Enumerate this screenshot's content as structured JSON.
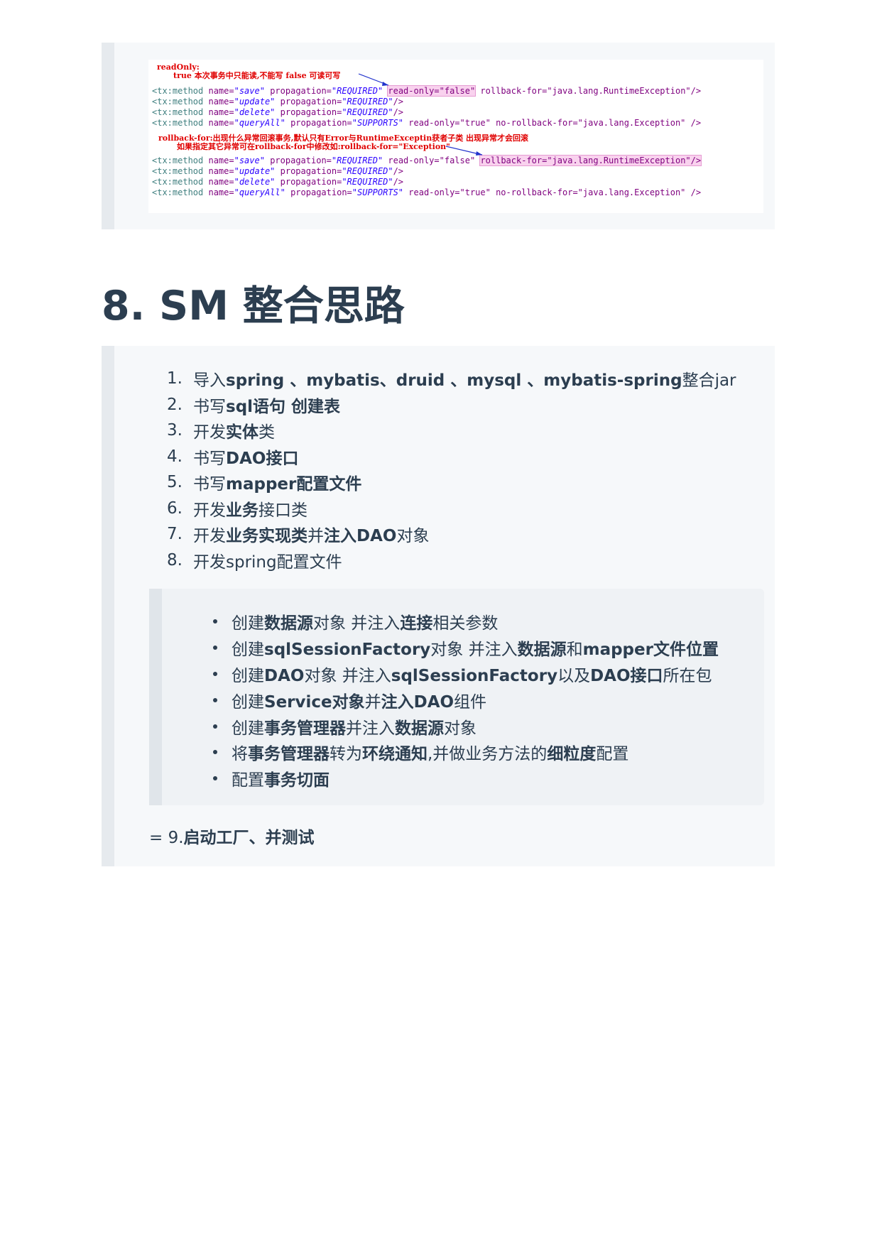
{
  "code_image": {
    "note1_line1": "readOnly:",
    "note1_line2": "true 本次事务中只能读,不能写 false 可读可写",
    "note2_line1": "rollback-for:出现什么异常回滚事务,默认只有Error与RuntimeExceptin获者子类 出现异常才会回滚",
    "note2_line2": "如果指定其它异常可在rollback-for中修改如:rollback-for=\"Exception\"",
    "block1": [
      {
        "name": "\"save\"",
        "prop": "\"REQUIRED\"",
        "extra": "read-only=\"false\"",
        "tail": " rollback-for=\"java.lang.RuntimeException\"/>"
      },
      {
        "name": "\"update\"",
        "prop": "\"REQUIRED\"",
        "extra": "",
        "tail": "/>"
      },
      {
        "name": "\"delete\"",
        "prop": "\"REQUIRED\"",
        "extra": "",
        "tail": "/>"
      },
      {
        "name": "\"queryAll\"",
        "prop": "\"SUPPORTS\"",
        "extra": "read-only=\"true\"",
        "tail": " no-rollback-for=\"java.lang.Exception\" />"
      }
    ],
    "block2": [
      {
        "name": "\"save\"",
        "prop": "\"REQUIRED\"",
        "extra": "read-only=\"false\"",
        "tail": "rollback-for=\"java.lang.RuntimeException\"/>"
      },
      {
        "name": "\"update\"",
        "prop": "\"REQUIRED\"",
        "extra": "",
        "tail": "/>"
      },
      {
        "name": "\"delete\"",
        "prop": "\"REQUIRED\"",
        "extra": "",
        "tail": "/>"
      },
      {
        "name": "\"queryAll\"",
        "prop": "\"SUPPORTS\"",
        "extra": "read-only=\"true\"",
        "tail": " no-rollback-for=\"java.lang.Exception\" />"
      }
    ]
  },
  "heading": "8. SM 整合思路",
  "steps": [
    {
      "num": "1.",
      "parts": [
        [
          "n",
          "导入"
        ],
        [
          "b",
          "spring 、mybatis、druid 、mysql 、mybatis-spring"
        ],
        [
          "n",
          "整合jar"
        ]
      ]
    },
    {
      "num": "2.",
      "parts": [
        [
          "n",
          "书写"
        ],
        [
          "b",
          "sql语句 创建表"
        ]
      ]
    },
    {
      "num": "3.",
      "parts": [
        [
          "n",
          "开发"
        ],
        [
          "b",
          "实体"
        ],
        [
          "n",
          "类"
        ]
      ]
    },
    {
      "num": "4.",
      "parts": [
        [
          "n",
          "书写"
        ],
        [
          "b",
          "DAO接口"
        ]
      ]
    },
    {
      "num": "5.",
      "parts": [
        [
          "n",
          "书写"
        ],
        [
          "b",
          "mapper配置文件"
        ]
      ]
    },
    {
      "num": "6.",
      "parts": [
        [
          "n",
          "开发"
        ],
        [
          "b",
          "业务"
        ],
        [
          "n",
          "接口类"
        ]
      ]
    },
    {
      "num": "7.",
      "parts": [
        [
          "n",
          "开发"
        ],
        [
          "b",
          "业务实现类"
        ],
        [
          "n",
          "并"
        ],
        [
          "b",
          "注入DAO"
        ],
        [
          "n",
          "对象"
        ]
      ]
    },
    {
      "num": "8.",
      "parts": [
        [
          "n",
          "开发spring配置文件"
        ]
      ]
    }
  ],
  "sub_steps": [
    [
      [
        "n",
        "创建"
      ],
      [
        "b",
        "数据源"
      ],
      [
        "n",
        "对象 并注入"
      ],
      [
        "b",
        "连接"
      ],
      [
        "n",
        "相关参数"
      ]
    ],
    [
      [
        "n",
        "创建"
      ],
      [
        "b",
        "sqlSessionFactory"
      ],
      [
        "n",
        "对象 并注入"
      ],
      [
        "b",
        "数据源"
      ],
      [
        "n",
        "和"
      ],
      [
        "b",
        "mapper文件位置"
      ]
    ],
    [
      [
        "n",
        "创建"
      ],
      [
        "b",
        "DAO"
      ],
      [
        "n",
        "对象 并注入"
      ],
      [
        "b",
        "sqlSessionFactory"
      ],
      [
        "n",
        "以及"
      ],
      [
        "b",
        "DAO接口"
      ],
      [
        "n",
        "所在包"
      ]
    ],
    [
      [
        "n",
        "创建"
      ],
      [
        "b",
        "Service对象"
      ],
      [
        "n",
        "并"
      ],
      [
        "b",
        "注入"
      ],
      [
        "b",
        "DAO"
      ],
      [
        "n",
        "组件"
      ]
    ],
    [
      [
        "n",
        "创建"
      ],
      [
        "b",
        "事务管理器"
      ],
      [
        "n",
        "并注入"
      ],
      [
        "b",
        "数据源"
      ],
      [
        "n",
        "对象"
      ]
    ],
    [
      [
        "n",
        "将"
      ],
      [
        "b",
        "事务管理器"
      ],
      [
        "n",
        "转为"
      ],
      [
        "b",
        "环绕通知"
      ],
      [
        "n",
        ",并做业务方法的"
      ],
      [
        "b",
        "细粒度"
      ],
      [
        "n",
        "配置"
      ]
    ],
    [
      [
        "n",
        "配置"
      ],
      [
        "b",
        "事务切面"
      ]
    ]
  ],
  "footer": [
    [
      "n",
      "= 9."
    ],
    [
      "b",
      "启动工厂、并测试"
    ]
  ],
  "colors": {
    "heading": "#2c3e50",
    "quote_bg": "#f6f8fa",
    "quote_border": "#e6eaee",
    "note_red": "#e00000",
    "code_string": "#2a00ff"
  }
}
